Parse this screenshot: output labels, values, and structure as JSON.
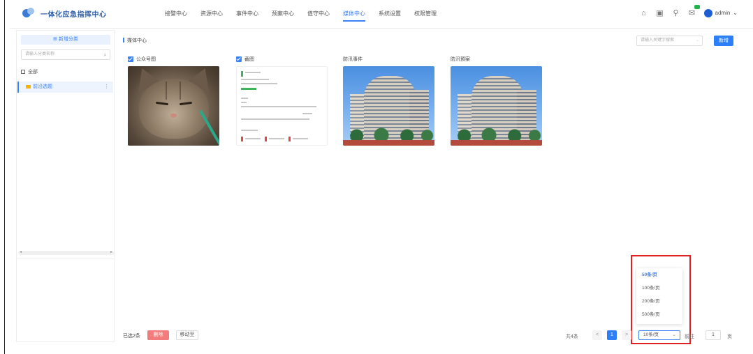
{
  "app": {
    "title": "一体化应急指挥中心"
  },
  "nav": {
    "items": [
      "接警中心",
      "资源中心",
      "事件中心",
      "预案中心",
      "值守中心",
      "媒体中心",
      "系统设置",
      "权限管理"
    ],
    "active_index": 5
  },
  "header": {
    "user_name": "admin"
  },
  "sidebar": {
    "new_category": "新增分类",
    "search_placeholder": "请输入分类名称",
    "all_label": "全部",
    "selected_category": "前沿选题"
  },
  "main": {
    "breadcrumb": "媒体中心",
    "search_placeholder": "请输入关键字搜索",
    "new_button": "新增",
    "cards": [
      {
        "title": "公众号图",
        "checked": true,
        "kind": "photo-cat"
      },
      {
        "title": "截图",
        "checked": true,
        "kind": "document"
      },
      {
        "title": "防汛事件",
        "checked": false,
        "kind": "building"
      },
      {
        "title": "防汛預案",
        "checked": false,
        "kind": "building"
      }
    ]
  },
  "footer": {
    "selected_text": "已选2条",
    "delete_button": "删除",
    "move_button": "移动至",
    "total_text": "共4条",
    "prev": "<",
    "current_page": "1",
    "next": ">",
    "page_size_value": "10条/页",
    "goto_label": "前往",
    "goto_value": "1",
    "page_suffix": "页"
  },
  "page_size_menu": {
    "options": [
      "50条/页",
      "100条/页",
      "200条/页",
      "500条/页"
    ],
    "selected_index": 0
  },
  "colors": {
    "accent": "#2d7ff9",
    "danger": "#f27b7b",
    "highlight": "#e02020"
  }
}
